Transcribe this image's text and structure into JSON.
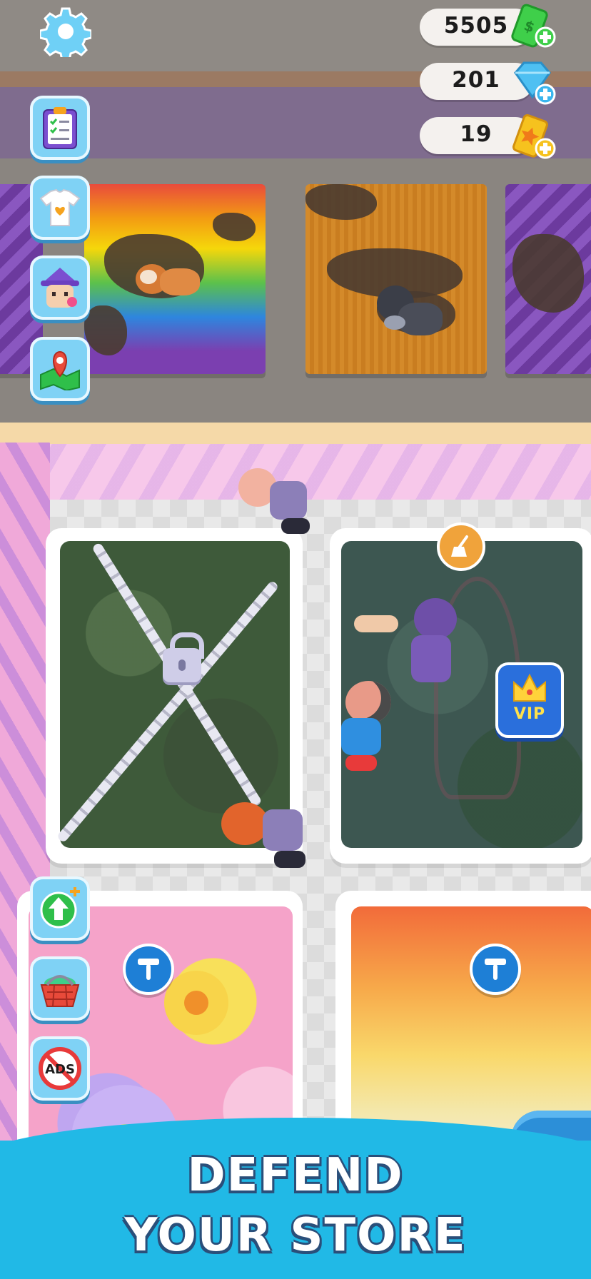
{
  "hud": {
    "settings_icon": "gear-icon",
    "currencies": [
      {
        "name": "cash",
        "value": "5505",
        "icon": "cash-plus-icon",
        "color": "#3fcf4a"
      },
      {
        "name": "gems",
        "value": "201",
        "icon": "diamond-plus-icon",
        "color": "#3ab6ee"
      },
      {
        "name": "tickets",
        "value": "19",
        "icon": "ticket-plus-icon",
        "color": "#f6c21e"
      }
    ]
  },
  "side_menu_top": [
    {
      "icon": "clipboard-checklist-icon"
    },
    {
      "icon": "tshirt-heart-icon"
    },
    {
      "icon": "wizard-avatar-icon"
    },
    {
      "icon": "map-pin-icon"
    }
  ],
  "side_menu_bottom": [
    {
      "icon": "upgrade-arrow-icon"
    },
    {
      "icon": "shopping-basket-icon"
    },
    {
      "icon": "no-ads-icon",
      "label": "ADS"
    }
  ],
  "shop": {
    "vip_label": "VIP",
    "slots": [
      {
        "state": "locked",
        "icon": "chain-lock-icon"
      },
      {
        "state": "dirty",
        "icon": "broom-icon"
      },
      {
        "state": "repair",
        "icon": "squeegee-icon"
      },
      {
        "state": "repair",
        "icon": "squeegee-icon"
      }
    ]
  },
  "banner": {
    "line1": "DEFEND",
    "line2": "YOUR STORE"
  },
  "colors": {
    "hud_button": "#7fd2f5",
    "banner": "#21b9e6",
    "vip": "#2a6fdc",
    "badge": "#1e7fd6"
  }
}
